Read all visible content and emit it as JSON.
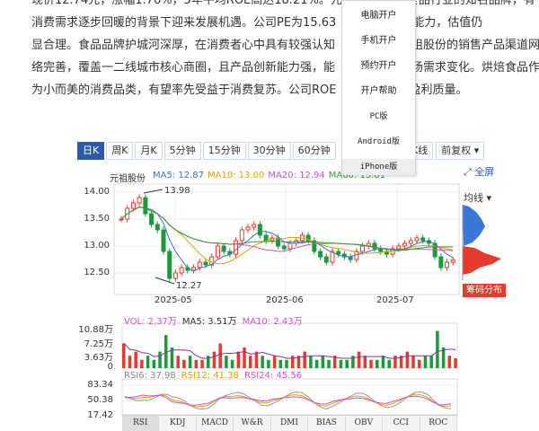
{
  "article": {
    "line1": "现价12.74元，涨幅1.76%，5年平均ROE高达18.21%。元",
    "line1b": "食品行业的知名品牌，有",
    "line2": "消费需求逐步回暖的背景下迎来发展机遇。公司PE为15.63",
    "line2b": "优异的盈利能力，估值仍",
    "line3": "显合理。食品品牌护城河深厚，在消费者心中具有较强认知",
    "line3b": "元祖股份的销售产品渠道网",
    "line4": "络完善，覆盖一二线城市核心商圈，且产品创新能力强，能",
    "line4b": "市场需求变化。烘焙食品作",
    "line5": "为小而美的消费品类，有望率先受益于消费复苏。公司ROE",
    "line5b": "示出良好的盈利质量。"
  },
  "dropdown": {
    "items": [
      {
        "label": "电脑开户",
        "name": "menu-pc-account"
      },
      {
        "label": "手机开户",
        "name": "menu-mobile-account"
      },
      {
        "label": "预约开户",
        "name": "menu-reserve-account"
      },
      {
        "label": "开户帮助",
        "name": "menu-account-help"
      },
      {
        "label": "PC版",
        "name": "menu-pc-version"
      },
      {
        "label": "Android版",
        "name": "menu-android-version"
      },
      {
        "label": "iPhone版",
        "name": "menu-iphone-version"
      }
    ]
  },
  "chart": {
    "tabs": [
      "日K",
      "周K",
      "月K",
      "5分钟",
      "15分钟",
      "30分钟",
      "60分钟"
    ],
    "active_tab": 0,
    "right_tabs": [
      "加叠K线",
      "前复权 ▾"
    ],
    "fullscreen": "全屏",
    "junxian": "均线 ▾",
    "stock_name": "元祖股份",
    "ma": [
      {
        "label": "MA5: 12.87",
        "color": "#3d6fc9"
      },
      {
        "label": "MA10: 13.00",
        "color": "#e0a000"
      },
      {
        "label": "MA20: 12.94",
        "color": "#d14fd1"
      },
      {
        "label": "MA60: 13.01",
        "color": "#2aa02a"
      }
    ],
    "price_axis": [
      "14.00",
      "13.50",
      "13.00",
      "12.50"
    ],
    "date_axis": [
      "2025-05",
      "2025-06",
      "2025-07"
    ],
    "max_label": "13.98",
    "min_label": "12.27",
    "chip_button": "筹码分布",
    "volume": {
      "legend": [
        {
          "label": "VOL: 2.37万",
          "color": "#d14fd1"
        },
        {
          "label": "MA5: 3.51万",
          "color": "#333333"
        },
        {
          "label": "MA10: 2.43万",
          "color": "#d14fd1"
        }
      ],
      "axis": [
        "10.88万",
        "7.25万",
        "3.63万",
        "0"
      ]
    },
    "rsi": {
      "legend": [
        {
          "label": "RSI6: 37.98",
          "color": "#888888"
        },
        {
          "label": "RSI12: 41.38",
          "color": "#e0a000"
        },
        {
          "label": "RSI24: 45.56",
          "color": "#d14fd1"
        }
      ],
      "axis": [
        "83.34",
        "50.38",
        "17.42"
      ]
    },
    "indicator_tabs": [
      "RSI",
      "KDJ",
      "MACD",
      "W&R",
      "DMI",
      "BIAS",
      "OBV",
      "CCI",
      "ROC"
    ],
    "active_indicator": 0
  }
}
